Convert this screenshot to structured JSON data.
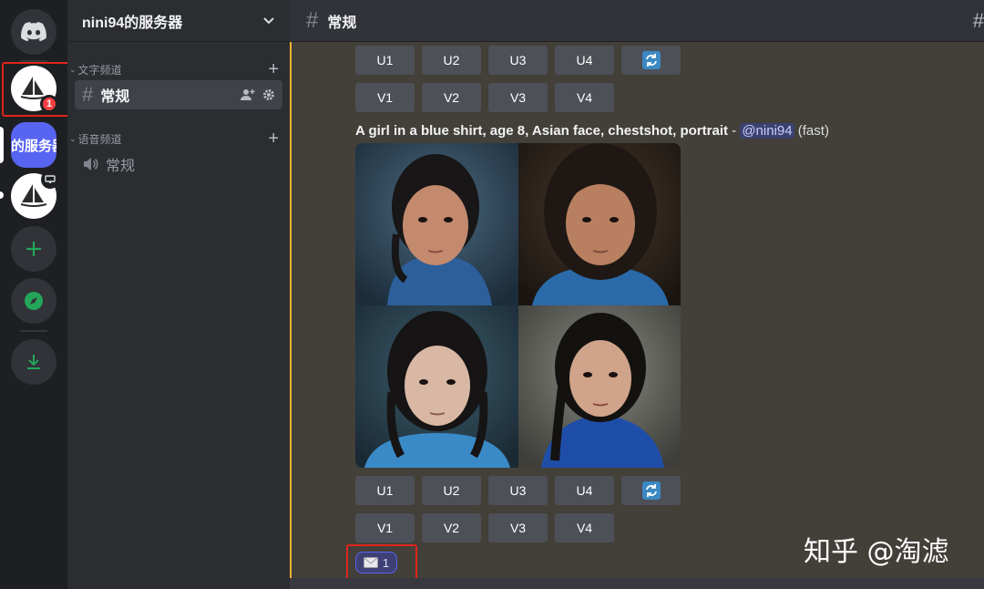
{
  "server": {
    "name": "nini94的服务器",
    "pill_label": "的服务器",
    "badge_count": "1"
  },
  "channels": {
    "text_category": "文字频道",
    "voice_category": "语音频道",
    "text_channel": "常规",
    "voice_channel": "常规"
  },
  "topbar": {
    "channel_name": "常规"
  },
  "buttons": {
    "upscale": [
      "U1",
      "U2",
      "U3",
      "U4"
    ],
    "variation": [
      "V1",
      "V2",
      "V3",
      "V4"
    ]
  },
  "message": {
    "prompt": "A girl in a blue shirt, age 8, Asian face, chestshot, portrait",
    "separator": " - ",
    "mention": "@nini94",
    "speed": "(fast)"
  },
  "reaction": {
    "count": "1"
  },
  "watermark": "知乎 @淘滤",
  "colors": {
    "accent": "#5865f2",
    "highlight_bar": "#f0b232",
    "badge": "#f23f42",
    "green": "#23a55a",
    "annotation_red": "#e0251b"
  },
  "icons": [
    "discord-logo",
    "sailboat-icon",
    "add-server-icon",
    "compass-icon",
    "download-icon",
    "hash-icon",
    "speaker-icon",
    "refresh-icon",
    "envelope-icon",
    "chevron-down-icon",
    "add-member-icon",
    "gear-icon"
  ]
}
